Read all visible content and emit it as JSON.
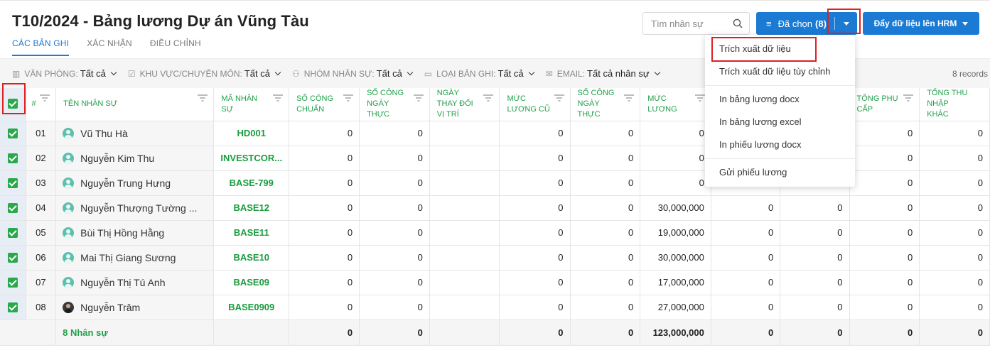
{
  "header": {
    "title": "T10/2024 - Bảng lương Dự án Vũng Tàu",
    "tabs": [
      {
        "label": "CÁC BẢN GHI",
        "active": true
      },
      {
        "label": "XÁC NHẬN",
        "active": false
      },
      {
        "label": "ĐIỀU CHỈNH",
        "active": false
      }
    ],
    "search_placeholder": "Tìm nhân sự",
    "selected_button": {
      "label": "Đã chọn",
      "count": "(8)"
    },
    "push_button": "Đẩy dữ liệu lên HRM"
  },
  "filters": [
    {
      "label": "VĂN PHÒNG:",
      "value": "Tất cả",
      "icon": "building-icon"
    },
    {
      "label": "KHU VỰC/CHUYÊN MÔN:",
      "value": "Tất cả",
      "icon": "check-square-icon"
    },
    {
      "label": "NHÓM NHÂN SỰ:",
      "value": "Tất cả",
      "icon": "users-icon"
    },
    {
      "label": "LOẠI BẢN GHI:",
      "value": "Tất cả",
      "icon": "folder-icon"
    },
    {
      "label": "EMAIL:",
      "value": "Tất cả nhân sự",
      "icon": "mail-icon"
    }
  ],
  "records_label": "8 records",
  "table": {
    "columns": [
      "#",
      "TÊN NHÂN SỰ",
      "MÃ NHÂN SỰ",
      "SỐ CÔNG CHUẨN",
      "SỐ CÔNG NGÀY THỰC",
      "NGÀY THAY ĐỔI VỊ TRÍ",
      "MỨC LƯƠNG CŨ",
      "SỐ CÔNG NGÀY THỰC",
      "MỨC LƯƠNG",
      "",
      "",
      "TỔNG PHỤ CẤP",
      "TỔNG THU NHẬP KHÁC"
    ],
    "rows": [
      {
        "idx": "01",
        "name": "Vũ Thu Hà",
        "code": "HD001",
        "c1": "0",
        "c2": "0",
        "c3": "",
        "c4": "0",
        "c5": "0",
        "c6": "0",
        "c7": "",
        "c8": "",
        "c9": "0",
        "c10": "0"
      },
      {
        "idx": "02",
        "name": "Nguyễn Kim Thu",
        "code": "INVESTCOR...",
        "c1": "0",
        "c2": "0",
        "c3": "",
        "c4": "0",
        "c5": "0",
        "c6": "0",
        "c7": "",
        "c8": "",
        "c9": "0",
        "c10": "0"
      },
      {
        "idx": "03",
        "name": "Nguyễn Trung Hưng",
        "code": "BASE-799",
        "c1": "0",
        "c2": "0",
        "c3": "",
        "c4": "0",
        "c5": "0",
        "c6": "0",
        "c7": "",
        "c8": "0",
        "c9": "0",
        "c10": "0"
      },
      {
        "idx": "04",
        "name": "Nguyễn Thượng Tường ...",
        "code": "BASE12",
        "c1": "0",
        "c2": "0",
        "c3": "",
        "c4": "0",
        "c5": "0",
        "c6": "30,000,000",
        "c7": "0",
        "c8": "0",
        "c9": "0",
        "c10": "0"
      },
      {
        "idx": "05",
        "name": "Bùi Thị Hồng Hằng",
        "code": "BASE11",
        "c1": "0",
        "c2": "0",
        "c3": "",
        "c4": "0",
        "c5": "0",
        "c6": "19,000,000",
        "c7": "0",
        "c8": "0",
        "c9": "0",
        "c10": "0"
      },
      {
        "idx": "06",
        "name": "Mai Thị Giang Sương",
        "code": "BASE10",
        "c1": "0",
        "c2": "0",
        "c3": "",
        "c4": "0",
        "c5": "0",
        "c6": "30,000,000",
        "c7": "0",
        "c8": "0",
        "c9": "0",
        "c10": "0"
      },
      {
        "idx": "07",
        "name": "Nguyễn Thị Tú Anh",
        "code": "BASE09",
        "c1": "0",
        "c2": "0",
        "c3": "",
        "c4": "0",
        "c5": "0",
        "c6": "17,000,000",
        "c7": "0",
        "c8": "0",
        "c9": "0",
        "c10": "0"
      },
      {
        "idx": "08",
        "name": "Nguyễn Trâm",
        "code": "BASE0909",
        "c1": "0",
        "c2": "0",
        "c3": "",
        "c4": "0",
        "c5": "0",
        "c6": "27,000,000",
        "c7": "0",
        "c8": "0",
        "c9": "0",
        "c10": "0"
      }
    ],
    "total": {
      "label": "8 Nhân sự",
      "c1": "0",
      "c2": "0",
      "c3": "",
      "c4": "0",
      "c5": "0",
      "c6": "123,000,000",
      "c7": "0",
      "c8": "0",
      "c9": "0",
      "c10": "0"
    }
  },
  "menu": {
    "items": [
      "Trích xuất dữ liệu",
      "Trích xuất dữ liệu tùy chỉnh",
      "In bảng lương docx",
      "In bảng lương excel",
      "In phiếu lương docx",
      "Gửi phiếu lương"
    ]
  },
  "colors": {
    "primary": "#1a7ad4",
    "green": "#22a04b",
    "highlight": "#e02020"
  }
}
